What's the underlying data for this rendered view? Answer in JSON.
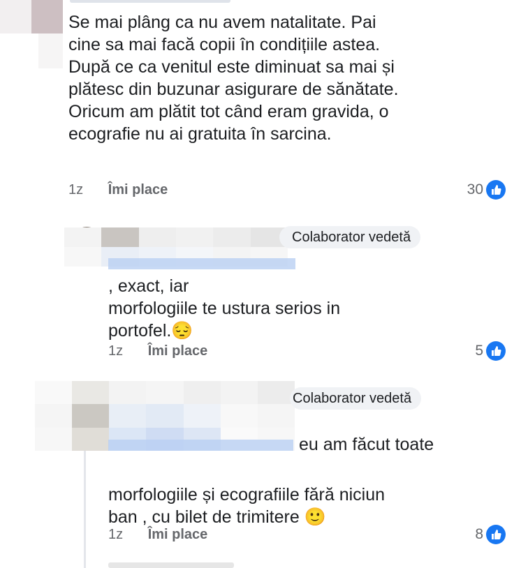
{
  "comments": [
    {
      "text": "Se mai plâng ca nu avem natalitate. Pai\ncine sa mai facă copii în condițiile astea.\nDupă ce ca venitul este diminuat sa mai și\nplătesc din buzunar asigurare de sănătate.\nOricum am plătit tot când eram gravida, o\necografie nu ai gratuita în sarcina.",
      "time": "1z",
      "like_label": "Îmi place",
      "reaction_count": "30"
    },
    {
      "badge": "Colaborator vedetă",
      "text": ", exact, iar\nmorfologiile te ustura serios in\nportofel.",
      "emoji": "😔",
      "time": "1z",
      "like_label": "Îmi place",
      "reaction_count": "5"
    },
    {
      "badge": "Colaborator vedetă",
      "text_line1": "eu am făcut toate",
      "text_rest": "morfologiile și ecografiile fără niciun\nban , cu bilet de trimitere",
      "emoji": "🙂",
      "time": "1z",
      "like_label": "Îmi place",
      "reaction_count": "8"
    }
  ],
  "colors": {
    "reaction_blue": "#1877f2",
    "meta_gray": "#65676b",
    "badge_bg": "#f0f2f5"
  }
}
